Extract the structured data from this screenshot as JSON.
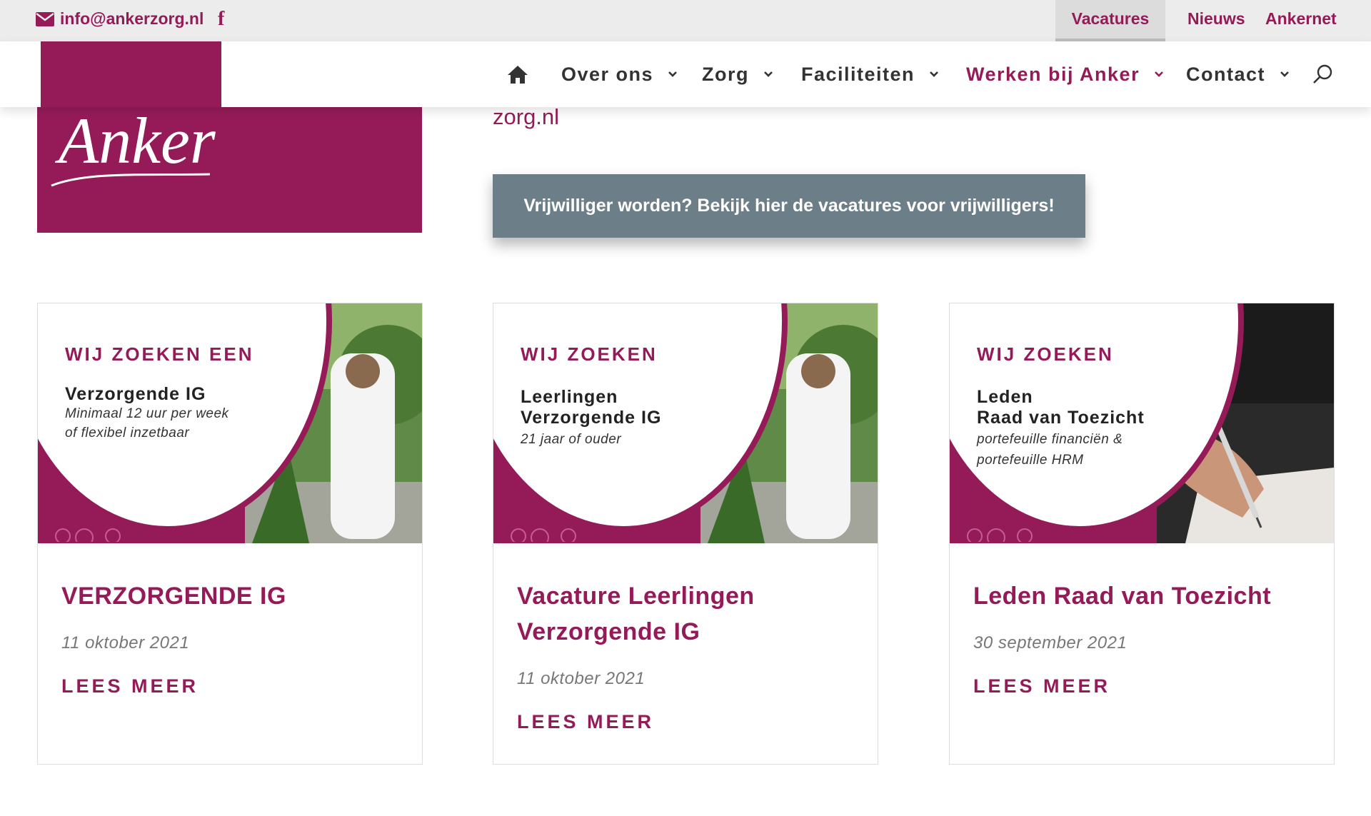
{
  "topbar": {
    "email": "info@ankerzorg.nl",
    "facebook_glyph": "f",
    "links": [
      "Vacatures",
      "Nieuws",
      "Ankernet"
    ]
  },
  "logo": {
    "text": "Anker"
  },
  "nav": {
    "items": [
      {
        "label": "Over ons",
        "active": false
      },
      {
        "label": "Zorg",
        "active": false
      },
      {
        "label": "Faciliteiten",
        "active": false
      },
      {
        "label": "Werken bij Anker",
        "active": true
      },
      {
        "label": "Contact",
        "active": false
      }
    ],
    "icons": [
      "home-icon",
      "chevron-down-icon",
      "search-icon"
    ]
  },
  "intro": {
    "partial_text": "zorg.nl"
  },
  "cta": {
    "label": "Vrijwilliger worden? Bekijk hier de vacatures voor vrijwilligers!"
  },
  "cards": [
    {
      "image": {
        "kicker": "WIJ ZOEKEN EEN",
        "title": [
          "Verzorgende IG"
        ],
        "subtitle": [
          "Minimaal 12 uur per week",
          "of flexibel inzetbaar"
        ]
      },
      "title": "VERZORGENDE IG",
      "date": "11 oktober 2021",
      "more": "LEES MEER"
    },
    {
      "image": {
        "kicker": "WIJ ZOEKEN",
        "title": [
          "Leerlingen",
          "Verzorgende IG"
        ],
        "subtitle": [
          "21 jaar of ouder"
        ]
      },
      "title": "Vacature Leerlingen Verzorgende IG",
      "date": "11 oktober 2021",
      "more": "LEES MEER"
    },
    {
      "image": {
        "kicker": "WIJ ZOEKEN",
        "title": [
          "Leden",
          "Raad van Toezicht"
        ],
        "subtitle": [
          "portefeuille financiën &",
          "portefeuille HRM"
        ]
      },
      "title": "Leden Raad van Toezicht",
      "date": "30 september 2021",
      "more": "LEES MEER"
    }
  ],
  "colors": {
    "brand": "#951b58",
    "cta": "#6c7f89",
    "topbar": "#ececec"
  }
}
